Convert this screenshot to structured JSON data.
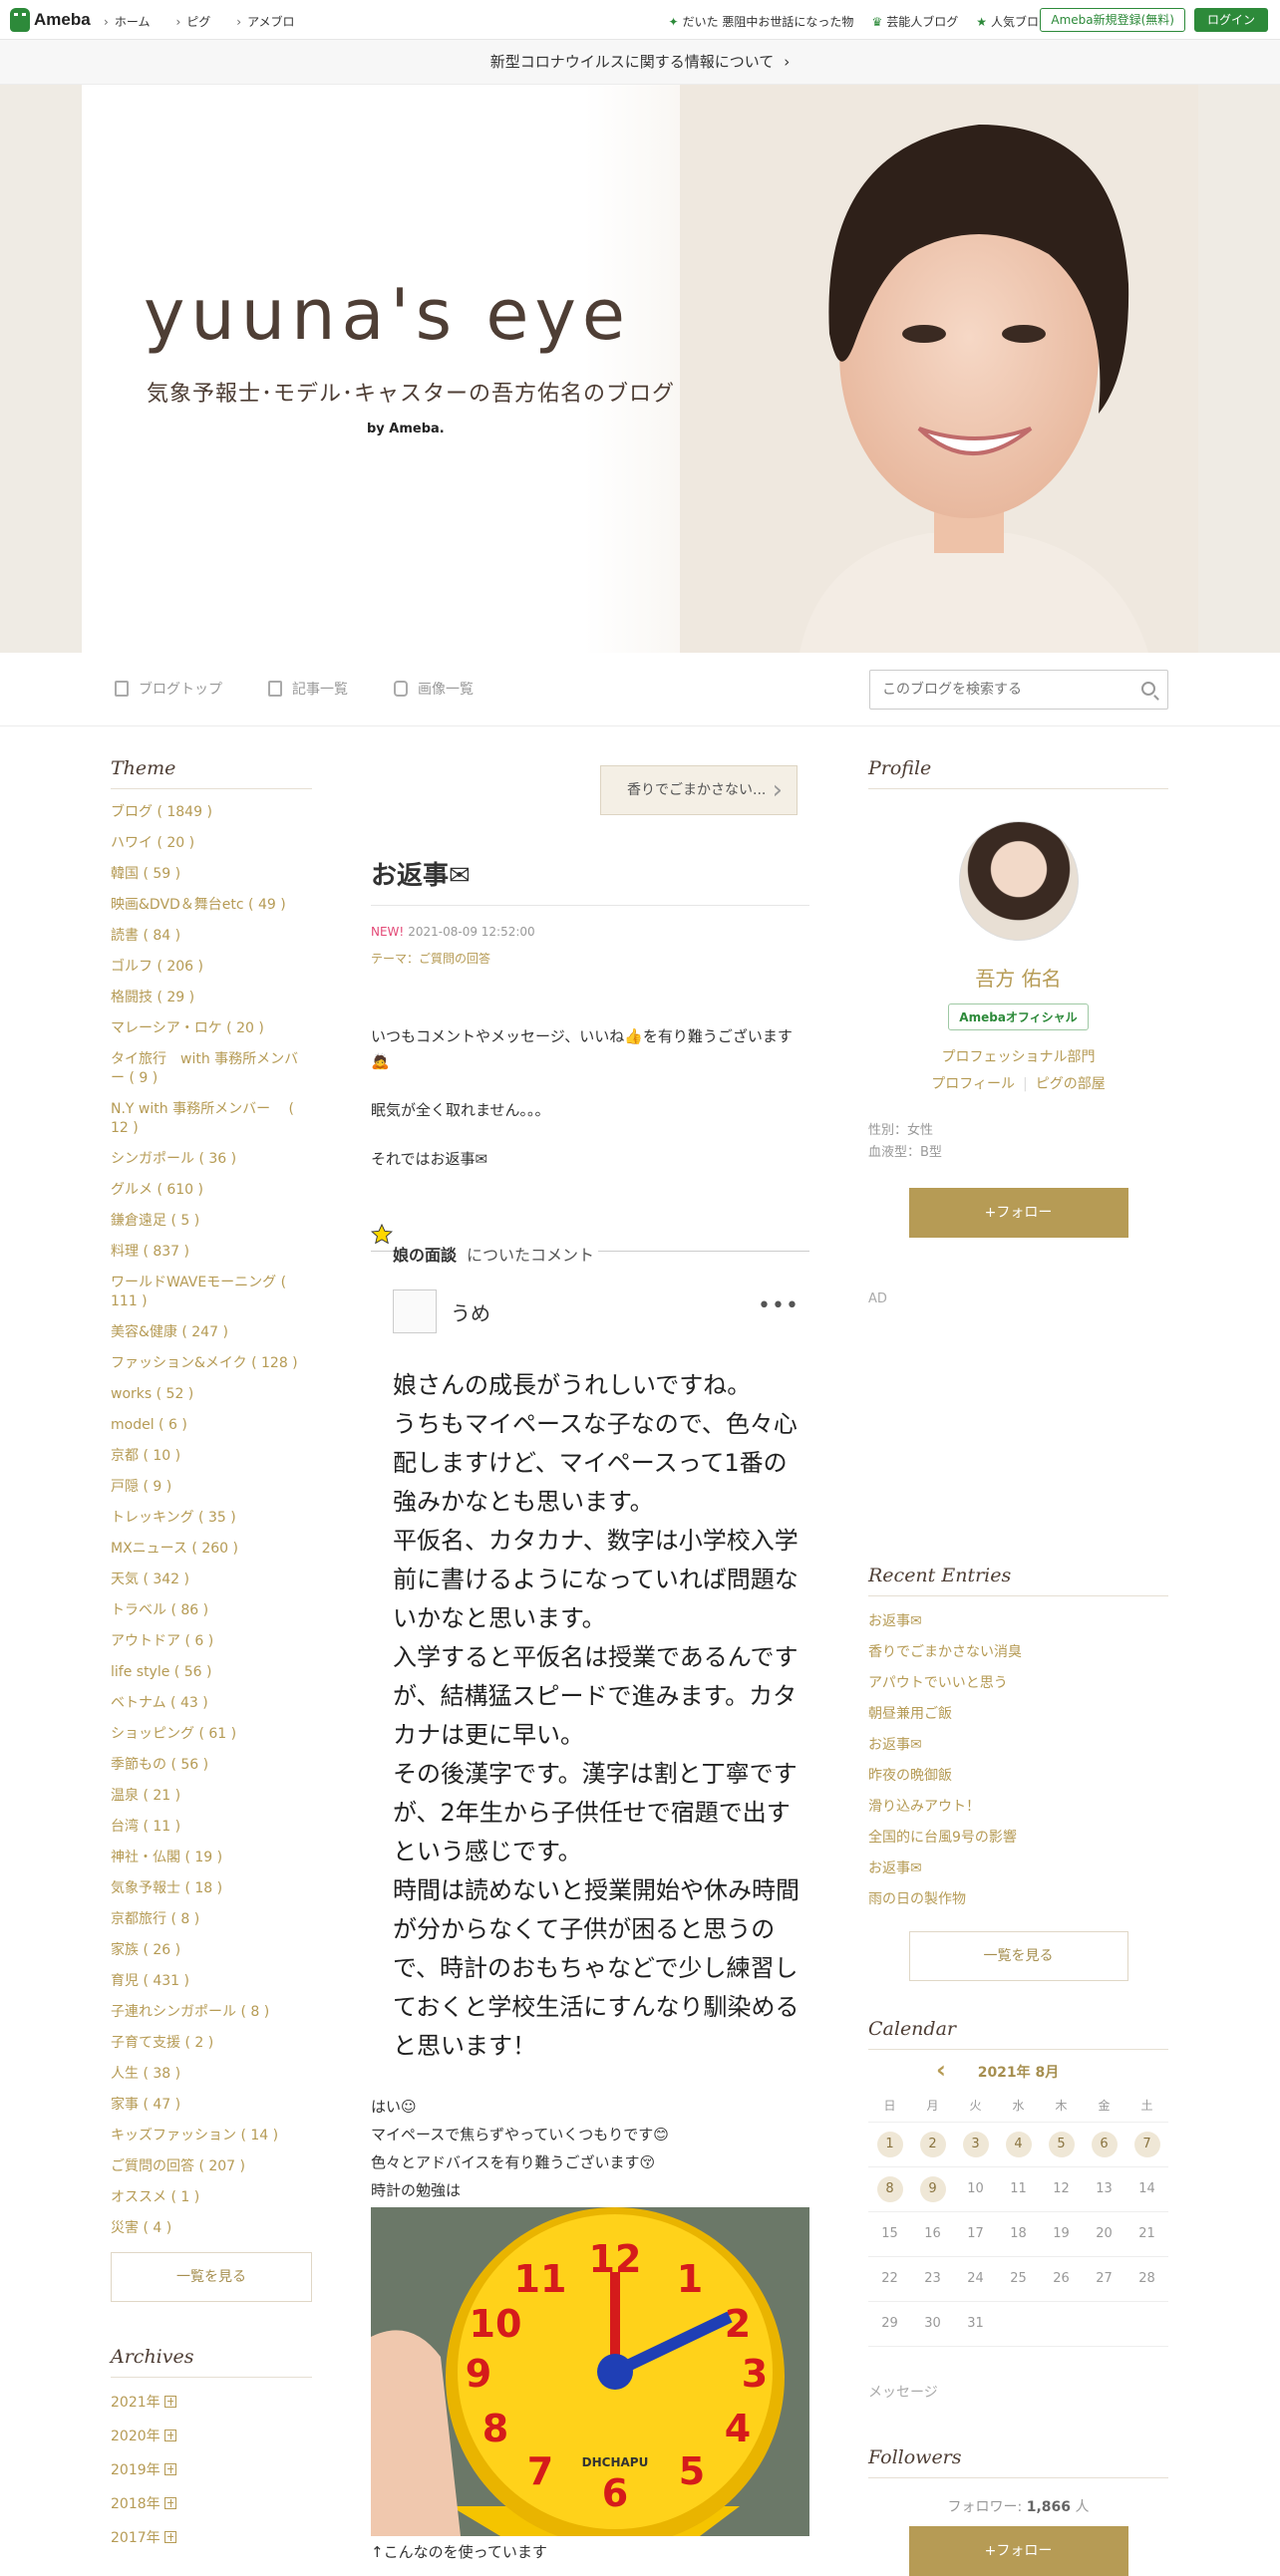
{
  "topbar": {
    "logo": "Ameba",
    "nav": [
      "ホーム",
      "ピグ",
      "アメブロ"
    ],
    "right_nav": [
      "だいた 悪阻中お世話になった物",
      "芸能人ブログ",
      "人気ブログ"
    ],
    "register": "Ameba新規登録(無料)",
    "login": "ログイン"
  },
  "notice": {
    "text": "新型コロナウイルスに関する情報について",
    "arrow": "›"
  },
  "header": {
    "title": "yuuna's eye",
    "subtitle": "気象予報士･モデル･キャスターの吾方佑名のブログ",
    "by": "by Ameba."
  },
  "subnav": {
    "items": [
      "ブログトップ",
      "記事一覧",
      "画像一覧"
    ],
    "search_placeholder": "このブログを検索する"
  },
  "left": {
    "theme_title": "Theme",
    "themes": [
      "ブログ ( 1849 )",
      "ハワイ ( 20 )",
      "韓国 ( 59 )",
      "映画&DVD＆舞台etc ( 49 )",
      "読書 ( 84 )",
      "ゴルフ ( 206 )",
      "格闘技 ( 29 )",
      "マレーシア・ロケ ( 20 )",
      "タイ旅行　with 事務所メンバー ( 9 )",
      "N.Y with 事務所メンバー　 ( 12 )",
      "シンガポール ( 36 )",
      "グルメ ( 610 )",
      "鎌倉遠足 ( 5 )",
      "料理 ( 837 )",
      "ワールドWAVEモーニング ( 111 )",
      "美容&健康 ( 247 )",
      "ファッション&メイク ( 128 )",
      "works ( 52 )",
      "model ( 6 )",
      "京都 ( 10 )",
      "戸隠 ( 9 )",
      "トレッキング ( 35 )",
      "MXニュース ( 260 )",
      "天気 ( 342 )",
      "トラベル ( 86 )",
      "アウトドア ( 6 )",
      "life style ( 56 )",
      "ベトナム ( 43 )",
      "ショッピング ( 61 )",
      "季節もの ( 56 )",
      "温泉 ( 21 )",
      "台湾 ( 11 )",
      "神社・仏閣 ( 19 )",
      "気象予報士 ( 18 )",
      "京都旅行 ( 8 )",
      "家族 ( 26 )",
      "育児 ( 431 )",
      "子連れシンガポール ( 8 )",
      "子育て支援 ( 2 )",
      "人生 ( 38 )",
      "家事 ( 47 )",
      "キッズファッション ( 14 )",
      "ご質問の回答 ( 207 )",
      "オススメ ( 1 )",
      "災害 ( 4 )"
    ],
    "theme_more": "一覧を見る",
    "archive_title": "Archives",
    "archives": [
      "2021年",
      "2020年",
      "2019年",
      "2018年",
      "2017年"
    ]
  },
  "entry": {
    "prev": "香りでごまかさない...",
    "title": "お返事✉",
    "new_label": "NEW!",
    "date": "2021-08-09 12:52:00",
    "theme": "テーマ：ご質問の回答",
    "body": [
      "いつもコメントやメッセージ、いいね👍を有り難うございます🙇",
      "眠気が全く取れません。。。",
      "それではお返事✉"
    ],
    "comment": {
      "article": "娘の面談",
      "suffix": "についたコメント",
      "user": "うめ",
      "more": "•••",
      "text": "娘さんの成長がうれしいですね。\nうちもマイペースな子なので、色々心配しますけど、マイペースって1番の強みかなとも思います。\n平仮名、カタカナ、数字は小学校入学前に書けるようになっていれば問題ないかなと思います。\n入学すると平仮名は授業であるんですが、結構猛スピードで進みます。カタカナは更に早い。\nその後漢字です。漢字は割と丁寧ですが、2年生から子供任せで宿題で出すという感じです。\n時間は読めないと授業開始や休み時間が分からなくて子供が困ると思うので、時計のおもちゃなどで少し練習しておくと学校生活にすんなり馴染めると思います！"
    },
    "reply": [
      "はい☺",
      "マイペースで焦らずやっていくつもりです😊",
      "色々とアドバイスを有り難うございます😚",
      "時計の勉強は"
    ],
    "clock_brand": "DHCHAPU",
    "caption": "↑こんなのを使っています"
  },
  "profile": {
    "title": "Profile",
    "name": "吾方 佑名",
    "badge": "Amebaオフィシャル",
    "category": "プロフェッショナル部門",
    "links": [
      "プロフィール",
      "ピグの部屋"
    ],
    "gender": "性別：女性",
    "blood": "血液型：B型",
    "follow": "+フォロー",
    "ad": "AD"
  },
  "recent": {
    "title": "Recent Entries",
    "items": [
      "お返事✉",
      "香りでごまかさない消臭",
      "アパウトでいいと思う",
      "朝昼兼用ご飯",
      "お返事✉",
      "昨夜の晩御飯",
      "滑り込みアウト！",
      "全国的に台風9号の影響",
      "お返事✉",
      "雨の日の製作物"
    ],
    "more": "一覧を見る"
  },
  "calendar": {
    "title": "Calendar",
    "month": "2021年 8月",
    "weekdays": [
      "日",
      "月",
      "火",
      "水",
      "木",
      "金",
      "土"
    ],
    "weeks": [
      [
        "1",
        "2",
        "3",
        "4",
        "5",
        "6",
        "7"
      ],
      [
        "8",
        "9",
        "10",
        "11",
        "12",
        "13",
        "14"
      ],
      [
        "15",
        "16",
        "17",
        "18",
        "19",
        "20",
        "21"
      ],
      [
        "22",
        "23",
        "24",
        "25",
        "26",
        "27",
        "28"
      ],
      [
        "29",
        "30",
        "31",
        "",
        "",
        "",
        ""
      ]
    ],
    "posted_days": [
      "1",
      "2",
      "3",
      "4",
      "5",
      "6",
      "7",
      "8",
      "9"
    ]
  },
  "message": "メッセージ",
  "followers": {
    "title": "Followers",
    "label": "フォロワー:",
    "count": "1,866",
    "unit": "人",
    "follow": "+フォロー"
  }
}
